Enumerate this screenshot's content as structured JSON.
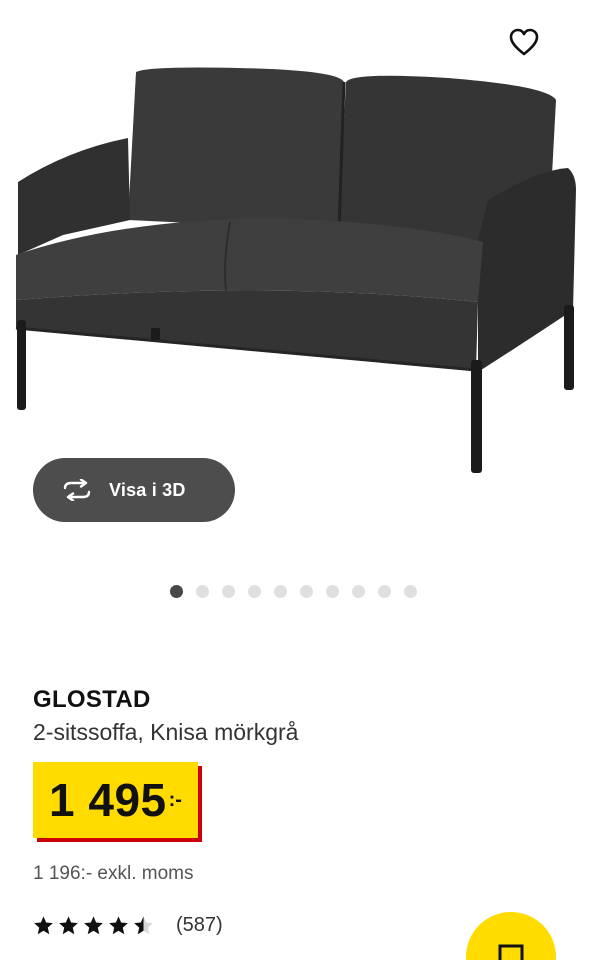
{
  "gallery": {
    "image_alt": "GLOSTAD 2-sitssoffa, Knisa mörkgrå",
    "favorite_icon": "heart-icon",
    "view3d": {
      "label": "Visa i 3D",
      "icon": "rotate-3d-icon"
    },
    "image_count": 10,
    "active_image": 1
  },
  "product": {
    "name": "GLOSTAD",
    "description": "2-sitssoffa, Knisa mörkgrå"
  },
  "price": {
    "main": "1 495",
    "suffix": ":-",
    "ex_vat": "1 196:- exkl. moms"
  },
  "rating": {
    "stars": 4.5,
    "max": 5,
    "count_label": "(587)"
  },
  "cart_button": {
    "icon": "cart-icon"
  },
  "colors": {
    "price_bg": "#ffdb00",
    "price_shadow": "#cc0008",
    "pill_bg": "#4d4d4d"
  }
}
